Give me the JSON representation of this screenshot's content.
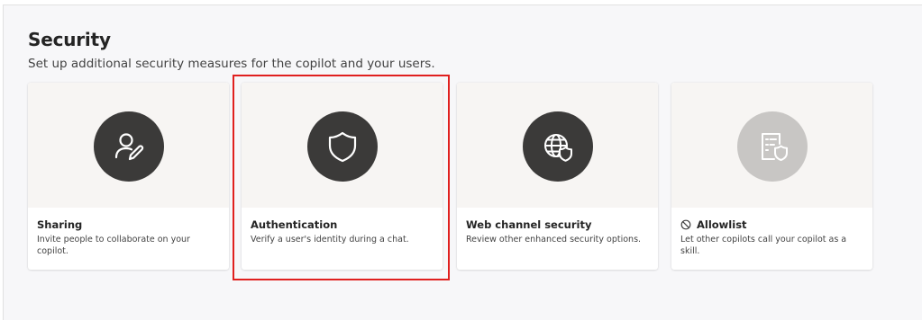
{
  "security": {
    "title": "Security",
    "subtitle": "Set up additional security measures for the copilot and your users.",
    "cards": [
      {
        "title": "Sharing",
        "description": "Invite people to collaborate on your copilot.",
        "icon": "person-edit-icon",
        "enabled": true
      },
      {
        "title": "Authentication",
        "description": "Verify a user's identity during a chat.",
        "icon": "shield-icon",
        "enabled": true,
        "highlighted": true
      },
      {
        "title": "Web channel security",
        "description": "Review other enhanced security options.",
        "icon": "globe-shield-icon",
        "enabled": true
      },
      {
        "title": "Allowlist",
        "description": "Let other copilots call your copilot as a skill.",
        "icon": "document-shield-icon",
        "status_icon": "block-icon",
        "enabled": false
      }
    ]
  },
  "colors": {
    "highlight_border": "#e0201f",
    "icon_circle": "#3b3a39",
    "icon_circle_disabled": "#c8c6c4"
  }
}
